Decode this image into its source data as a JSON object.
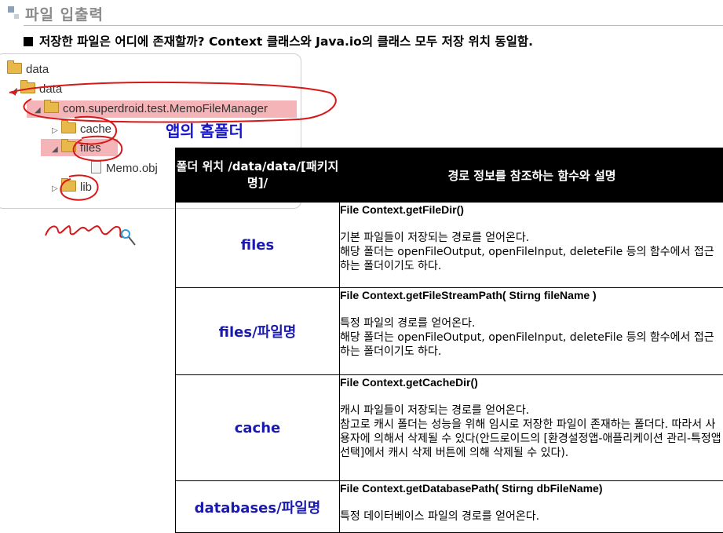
{
  "header": {
    "title": "파일 입출력",
    "subtitle": "저장한 파일은 어디에 존재할까? Context 클래스와 Java.io의 클래스 모두 저장 위치 동일함."
  },
  "tree": {
    "root": "data",
    "data": "data",
    "package": "com.superdroid.test.MemoFileManager",
    "cache": "cache",
    "files": "files",
    "memo": "Memo.obj",
    "lib": "lib"
  },
  "annotation": "앱의 홈폴더",
  "table": {
    "header_left": "폴더 위치 /data/data/[패키지명]/",
    "header_right": "경로 정보를 참조하는 함수와 설명",
    "rows": [
      {
        "name": "files",
        "function": "File Context.getFileDir()",
        "lines": [
          "기본 파일들이 저장되는 경로를 얻어온다.",
          "해당 폴더는 openFileOutput, openFileInput, deleteFile 등의 함수에서 접근하는 폴더이기도 하다."
        ]
      },
      {
        "name": "files/파일명",
        "function": "File Context.getFileStreamPath( Stirng fileName )",
        "lines": [
          "특정 파일의 경로를 얻어온다.",
          "해당 폴더는 openFileOutput, openFileInput, deleteFile 등의 함수에서 접근하는 폴더이기도 하다."
        ]
      },
      {
        "name": "cache",
        "function": "File Context.getCacheDir()",
        "lines": [
          "캐시 파일들이 저장되는 경로를 얻어온다.",
          "참고로 캐시 폴더는 성능을 위해 임시로 저장한 파일이 존재하는 폴더다. 따라서 사용자에 의해서 삭제될 수 있다(안드로이드의 [환경설정앱-애플리케이션 관리-특정앱 선택]에서 캐시 삭제 버튼에 의해 삭제될 수 있다)."
        ]
      },
      {
        "name": "databases/파일명",
        "function": "File Context.getDatabasePath( Stirng dbFileName)",
        "lines": [
          "특정 데이터베이스 파일의 경로를 얻어온다."
        ]
      }
    ]
  },
  "colors": {
    "highlight": "#f4b4b8",
    "ink": "#d81818",
    "blue_text": "#1a1ab0"
  }
}
